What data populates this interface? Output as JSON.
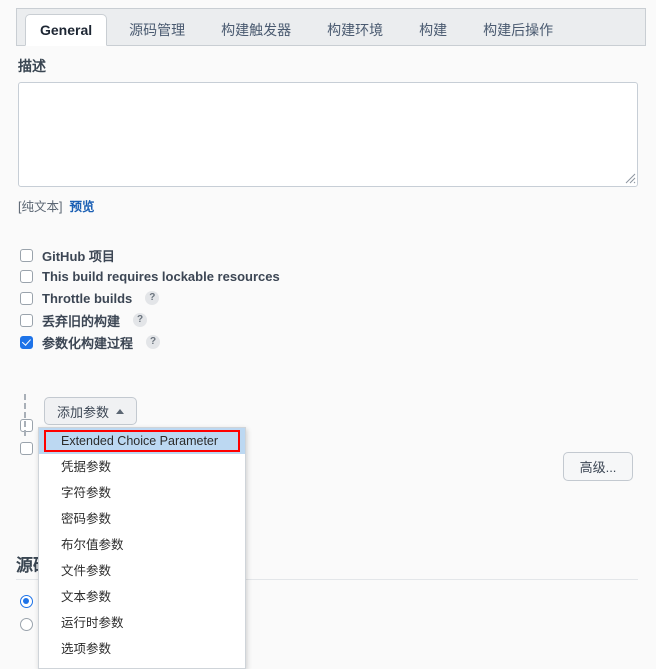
{
  "tabs": [
    {
      "label": "General",
      "active": true
    },
    {
      "label": "源码管理",
      "active": false
    },
    {
      "label": "构建触发器",
      "active": false
    },
    {
      "label": "构建环境",
      "active": false
    },
    {
      "label": "构建",
      "active": false
    },
    {
      "label": "构建后操作",
      "active": false
    }
  ],
  "description": {
    "label": "描述",
    "value": "",
    "placeholder": "",
    "format_note": "[纯文本]",
    "preview_link": "预览"
  },
  "options": [
    {
      "label": "GitHub 项目",
      "checked": false,
      "help": false
    },
    {
      "label": "This build requires lockable resources",
      "checked": false,
      "help": false
    },
    {
      "label": "Throttle builds",
      "checked": false,
      "help": true
    },
    {
      "label": "丢弃旧的构建",
      "checked": false,
      "help": true
    },
    {
      "label": "参数化构建过程",
      "checked": true,
      "help": true
    }
  ],
  "hidden_options": [
    {
      "label": "",
      "checked": false
    },
    {
      "label": "",
      "checked": false
    }
  ],
  "add_param": {
    "button_label": "添加参数",
    "caret": "caret-up-icon",
    "menu_items": [
      {
        "label": "Extended Choice Parameter",
        "highlighted": true
      },
      {
        "label": "凭据参数",
        "highlighted": false
      },
      {
        "label": "字符参数",
        "highlighted": false
      },
      {
        "label": "密码参数",
        "highlighted": false
      },
      {
        "label": "布尔值参数",
        "highlighted": false
      },
      {
        "label": "文件参数",
        "highlighted": false
      },
      {
        "label": "文本参数",
        "highlighted": false
      },
      {
        "label": "运行时参数",
        "highlighted": false
      },
      {
        "label": "选项参数",
        "highlighted": false
      }
    ]
  },
  "advanced_button": {
    "label": "高级..."
  },
  "scm": {
    "heading": "源码管理",
    "radios": [
      {
        "label": "",
        "selected": true
      },
      {
        "label": "",
        "selected": false
      }
    ]
  },
  "help_glyph": "?",
  "colors": {
    "accent_blue": "#1e73e8",
    "link_blue": "#1a5fb4",
    "highlight_blue": "#bcd8f2",
    "callout_red": "#ff0000",
    "page_bg": "#fafafa",
    "tabbar_bg": "#ebedef"
  }
}
